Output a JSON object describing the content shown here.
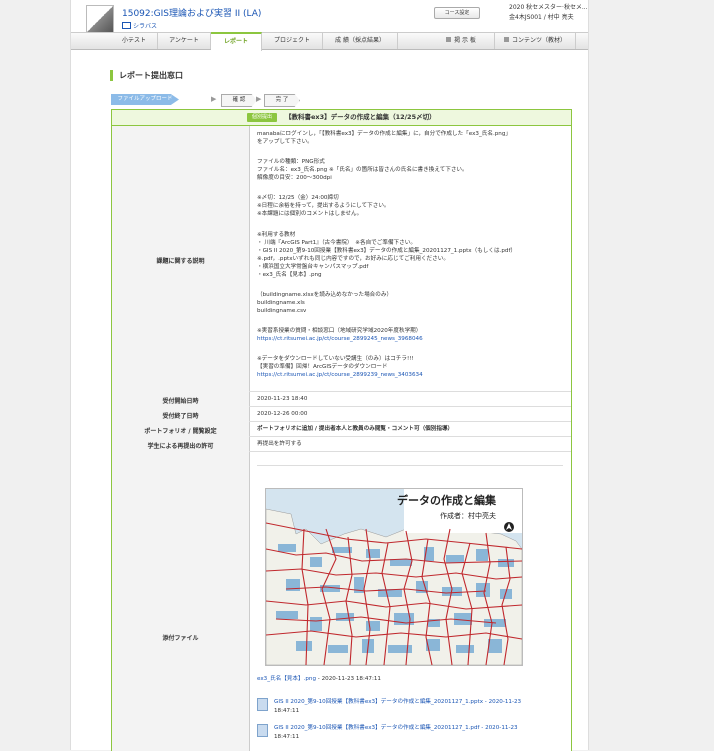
{
  "header": {
    "course_title": "15092:GIS理論および実習 II (LA)",
    "syllabus_label": "シラバス",
    "course_settings_label": "コース設定",
    "semester": "2020 秋セメスター·秋セメ...",
    "user": "金4木JS001 / 村中 亮夫"
  },
  "nav": {
    "tabs": [
      {
        "label": "小テスト"
      },
      {
        "label": "アンケート"
      },
      {
        "label": "レポート"
      },
      {
        "label": "プロジェクト"
      },
      {
        "label": "成 績（採点結果）"
      },
      {
        "label": "掲 示 板"
      },
      {
        "label": "コンテンツ（教材）"
      }
    ]
  },
  "section_title": "レポート提出窓口",
  "steps": {
    "upload": "ファイルアップロード",
    "confirm": "確 認",
    "done": "完 了"
  },
  "report": {
    "badge": "個別提出",
    "subject": "【教科書ex3】データの作成と編集（12/25〆切）",
    "labels": {
      "description": "課題に関する説明",
      "start": "受付開始日時",
      "end": "受付終了日時",
      "portfolio": "ポートフォリオ / 閲覧設定",
      "resubmit": "学生による再提出の許可",
      "attachment": "添付ファイル"
    },
    "description_lines": [
      "manabaにログインし，「【教科書ex3】データの作成と編集」に，自分で作成した「ex3_氏名.png」",
      "をアップして下さい。",
      "",
      "ファイルの種類：PNG形式",
      "ファイル名：ex3_氏名.png ※「氏名」の箇所は皆さんの氏名に書き換えて下さい。",
      "解像度の目安：200～300dpi",
      "",
      "※〆切：12/25（金）24:00締切",
      "※日程に余裕を持って，提出するようにして下さい。",
      "※本課題には個別のコメントはしません。",
      "",
      "※利用する教材",
      "・ 川端『ArcGIS Part1』（古今書院）　※各自でご準備下さい。",
      "・GIS II 2020_第9-10回授業【教科書ex3】データの作成と編集_20201127_1.pptx（もしくは.pdf）",
      "※.pdf，.pptxいずれも同じ内容ですので，お好みに応じてご利用ください。",
      "・横浜国立大学常盤台キャンパスマップ.pdf",
      "・ex3_氏名【見本】.png",
      "",
      "（buildingname.xlsxを読み込めなかった場合のみ）",
      "buildingname.xls",
      "buildingname.csv",
      "",
      "※実習系授業の質問・相談窓口（地域研究学域2020年度秋学期）",
      "https://ct.ritsumei.ac.jp/ct/course_2899245_news_3968046",
      "",
      "※データをダウンロードしていない受講生（のみ）はコチラ!!!",
      "【実習の準備】回帰！ArcGISデータのダウンロード",
      "https://ct.ritsumei.ac.jp/ct/course_2899239_news_3403634"
    ],
    "start_value": "2020-11-23 18:40",
    "end_value": "2020-12-26 00:00",
    "portfolio_value": "ポートフォリオに追加 / 提出者本人と教員のみ閲覧・コメント可（個別指導）",
    "resubmit_value": "再提出を許可する",
    "map": {
      "title": "データの作成と編集",
      "author": "作成者：村中亮夫"
    },
    "attachment_sample": "ex3_氏名【見本】.png",
    "attachment_sample_date": " - 2020-11-23 18:47:11",
    "files": [
      {
        "name": "GIS II 2020_第9-10回授業【教科書ex3】データの作成と編集_20201127_1.pptx - 2020-11-23",
        "date": "18:47:11"
      },
      {
        "name": "GIS II 2020_第9-10回授業【教科書ex3】データの作成と編集_20201127_1.pdf - 2020-11-23",
        "date": "18:47:11"
      }
    ]
  }
}
